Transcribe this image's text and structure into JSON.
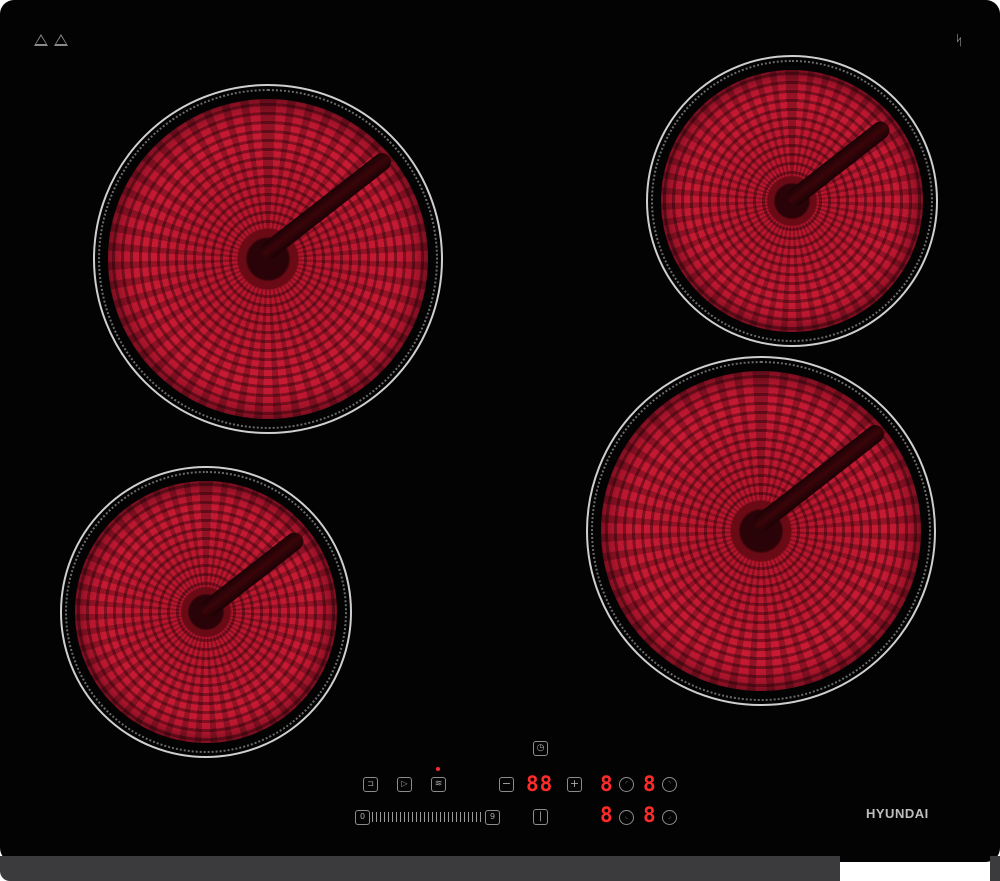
{
  "appliance": {
    "brand": "HYUNDAI",
    "type": "ceramic-hob",
    "zones_count": 4
  },
  "top_icons": [
    {
      "name": "hot-surface-warning-icon",
      "color": "#8a8a8a"
    },
    {
      "name": "caution-warning-icon",
      "color": "#8a8a8a"
    },
    {
      "name": "wireless-connect-icon",
      "color": "#9a9a9a"
    }
  ],
  "controls": {
    "lock_label": "⊏ꟷ",
    "pause_label": "▷",
    "keep_warm_label": "♨",
    "timer_label": "🕒",
    "minus_label": "−",
    "plus_label": "+",
    "timer_display": "88",
    "slider_min": "0",
    "slider_max": "9",
    "power_label": "|",
    "zone_displays": [
      {
        "zone": "rear-left",
        "value": "8"
      },
      {
        "zone": "rear-right",
        "value": "8"
      },
      {
        "zone": "front-left",
        "value": "8"
      },
      {
        "zone": "front-right",
        "value": "8"
      }
    ]
  },
  "colors": {
    "panel": "#040304",
    "heating_red": "#c71a33",
    "display_red": "#ff2a2a",
    "ring": "#cfcfcf"
  }
}
